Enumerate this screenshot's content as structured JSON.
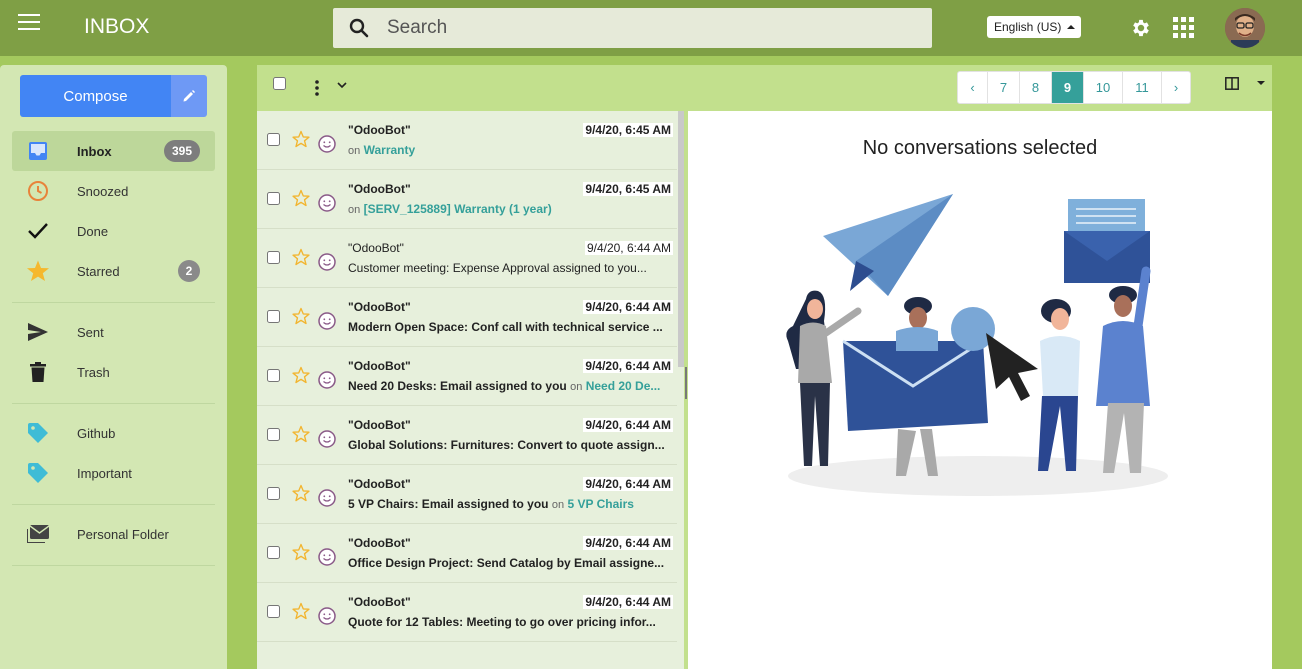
{
  "app": {
    "title": "INBOX"
  },
  "search": {
    "placeholder": "Search"
  },
  "language": {
    "selected": "English (US)"
  },
  "colors": {
    "topbar": "#7f9f45",
    "accent": "#35a09a",
    "compose": "#4285f4"
  },
  "compose": {
    "label": "Compose"
  },
  "sidebar": {
    "items": [
      {
        "key": "inbox",
        "label": "Inbox",
        "count": "395",
        "icon": "inbox-icon",
        "active": true
      },
      {
        "key": "snoozed",
        "label": "Snoozed",
        "icon": "clock-icon"
      },
      {
        "key": "done",
        "label": "Done",
        "icon": "check-icon"
      },
      {
        "key": "starred",
        "label": "Starred",
        "count": "2",
        "icon": "star-icon"
      },
      {
        "key": "sent",
        "label": "Sent",
        "icon": "send-icon"
      },
      {
        "key": "trash",
        "label": "Trash",
        "icon": "trash-icon"
      },
      {
        "key": "github",
        "label": "Github",
        "icon": "tag-icon"
      },
      {
        "key": "important",
        "label": "Important",
        "icon": "tag-icon"
      },
      {
        "key": "personal",
        "label": "Personal Folder",
        "icon": "folder-mail-icon"
      }
    ]
  },
  "pager": {
    "prev": "‹",
    "pages": [
      "7",
      "8",
      "9",
      "10",
      "11"
    ],
    "current": "9",
    "next": "›"
  },
  "threads": [
    {
      "from": "\"OdooBot\"",
      "date": "9/4/20, 6:45 AM",
      "subject": "",
      "on": "on",
      "link": "Warranty",
      "unread": true
    },
    {
      "from": "\"OdooBot\"",
      "date": "9/4/20, 6:45 AM",
      "subject": "",
      "on": "on",
      "link": "[SERV_125889] Warranty (1 year)",
      "unread": true
    },
    {
      "from": "\"OdooBot\"",
      "date": "9/4/20, 6:44 AM",
      "subject": "Customer meeting: Expense Approval assigned to you...",
      "on": "",
      "link": "",
      "unread": false
    },
    {
      "from": "\"OdooBot\"",
      "date": "9/4/20, 6:44 AM",
      "subject": "Modern Open Space: Conf call with technical service ...",
      "on": "",
      "link": "",
      "unread": true
    },
    {
      "from": "\"OdooBot\"",
      "date": "9/4/20, 6:44 AM",
      "subject": "Need 20 Desks: Email assigned to you",
      "on": "on",
      "link": "Need 20 De...",
      "unread": true
    },
    {
      "from": "\"OdooBot\"",
      "date": "9/4/20, 6:44 AM",
      "subject": "Global Solutions: Furnitures: Convert to quote assign...",
      "on": "",
      "link": "",
      "unread": true
    },
    {
      "from": "\"OdooBot\"",
      "date": "9/4/20, 6:44 AM",
      "subject": "5 VP Chairs: Email assigned to you",
      "on": "on",
      "link": "5 VP Chairs",
      "unread": true
    },
    {
      "from": "\"OdooBot\"",
      "date": "9/4/20, 6:44 AM",
      "subject": "Office Design Project: Send Catalog by Email assigne...",
      "on": "",
      "link": "",
      "unread": true
    },
    {
      "from": "\"OdooBot\"",
      "date": "9/4/20, 6:44 AM",
      "subject": "Quote for 12 Tables: Meeting to go over pricing infor...",
      "on": "",
      "link": "",
      "unread": true
    }
  ],
  "reading": {
    "empty_message": "No conversations selected"
  }
}
